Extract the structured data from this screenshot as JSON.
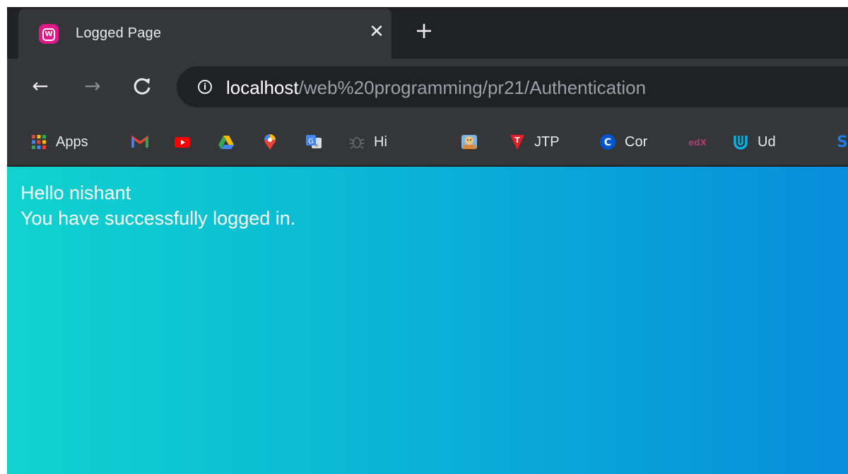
{
  "tab": {
    "title": "Logged Page",
    "close_glyph": "✕",
    "new_tab_glyph": "+"
  },
  "toolbar": {
    "back_glyph": "←",
    "forward_glyph": "→",
    "reload_glyph": "C",
    "url_host": "localhost",
    "url_path": "/web%20programming/pr21/Authentication"
  },
  "bookmarks": [
    {
      "label": "Apps",
      "icon": "apps-grid-icon"
    },
    {
      "label": "",
      "icon": "gmail-icon"
    },
    {
      "label": "",
      "icon": "youtube-icon"
    },
    {
      "label": "",
      "icon": "google-drive-icon"
    },
    {
      "label": "",
      "icon": "google-maps-icon"
    },
    {
      "label": "",
      "icon": "google-translate-icon"
    },
    {
      "label": "Hi",
      "icon": "bug-icon"
    },
    {
      "label": "",
      "icon": "avatar-icon"
    },
    {
      "label": "JTP",
      "icon": "javatpoint-icon"
    },
    {
      "label": "Cor",
      "icon": "coursera-icon"
    },
    {
      "label": "",
      "icon": "edx-icon"
    },
    {
      "label": "Ud",
      "icon": "udacity-icon"
    },
    {
      "label": "",
      "icon": "s-icon"
    }
  ],
  "page": {
    "greeting": "Hello nishant",
    "message": "You have successfully logged in."
  },
  "colors": {
    "gradient_start": "#11d3ce",
    "gradient_end": "#088ddc",
    "chrome_dark": "#202124",
    "chrome_toolbar": "#35363a"
  }
}
